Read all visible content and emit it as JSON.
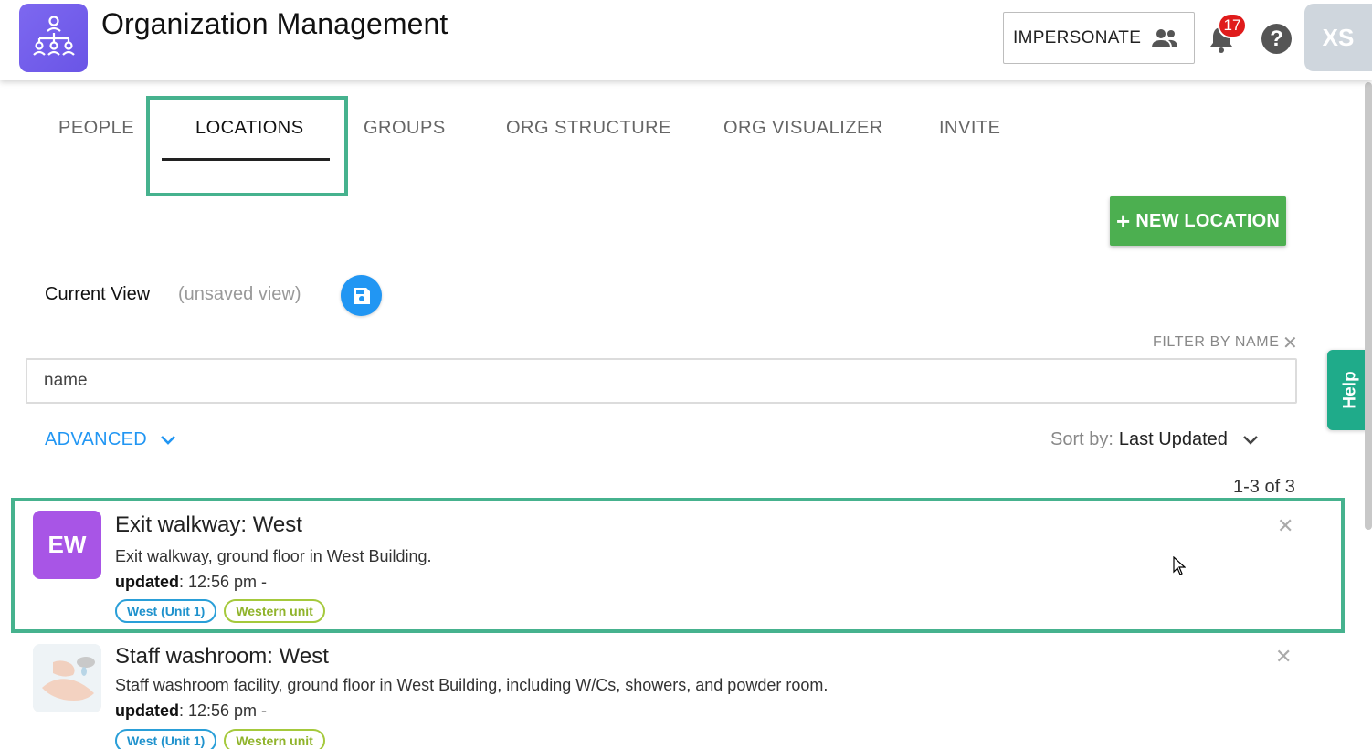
{
  "header": {
    "title": "Organization Management",
    "logo_icon": "org-chart-icon",
    "impersonate_label": "IMPERSONATE",
    "notification_count": "17",
    "help_symbol": "?",
    "avatar_initials": "XS"
  },
  "tabs": [
    {
      "label": "PEOPLE"
    },
    {
      "label": "LOCATIONS",
      "active": true
    },
    {
      "label": "GROUPS"
    },
    {
      "label": "ORG STRUCTURE"
    },
    {
      "label": "ORG VISUALIZER"
    },
    {
      "label": "INVITE"
    }
  ],
  "toolbar": {
    "new_location_plus": "+",
    "new_location_label": "NEW LOCATION"
  },
  "view": {
    "current_label": "Current View",
    "unsaved_label": "(unsaved view)"
  },
  "filter": {
    "label": "FILTER BY NAME",
    "clear_symbol": "✕",
    "value": "name"
  },
  "controls": {
    "advanced_label": "ADVANCED",
    "sort_label": "Sort by:",
    "sort_value": "Last Updated",
    "count": "1-3 of 3"
  },
  "locations": [
    {
      "initials": "EW",
      "name": "Exit walkway: West",
      "description": "Exit walkway, ground floor in West Building.",
      "updated_label": "updated",
      "updated_value": ": 12:56 pm -",
      "tags": [
        "West (Unit 1)",
        "Western unit"
      ],
      "close_symbol": "✕"
    },
    {
      "initials": "",
      "name": "Staff washroom: West",
      "description": "Staff washroom facility, ground floor in West Building, including W/Cs, showers, and powder room.",
      "updated_label": "updated",
      "updated_value": ": 12:56 pm -",
      "tags": [
        "West (Unit 1)",
        "Western unit"
      ],
      "close_symbol": "✕"
    }
  ],
  "help_tab": {
    "label": "Help"
  },
  "colors": {
    "accent_blue": "#2196f3",
    "brand_purple": "#7d68f0",
    "highlight_green": "#46b28e",
    "button_green": "#4caf50",
    "badge_red": "#e01b1b"
  }
}
